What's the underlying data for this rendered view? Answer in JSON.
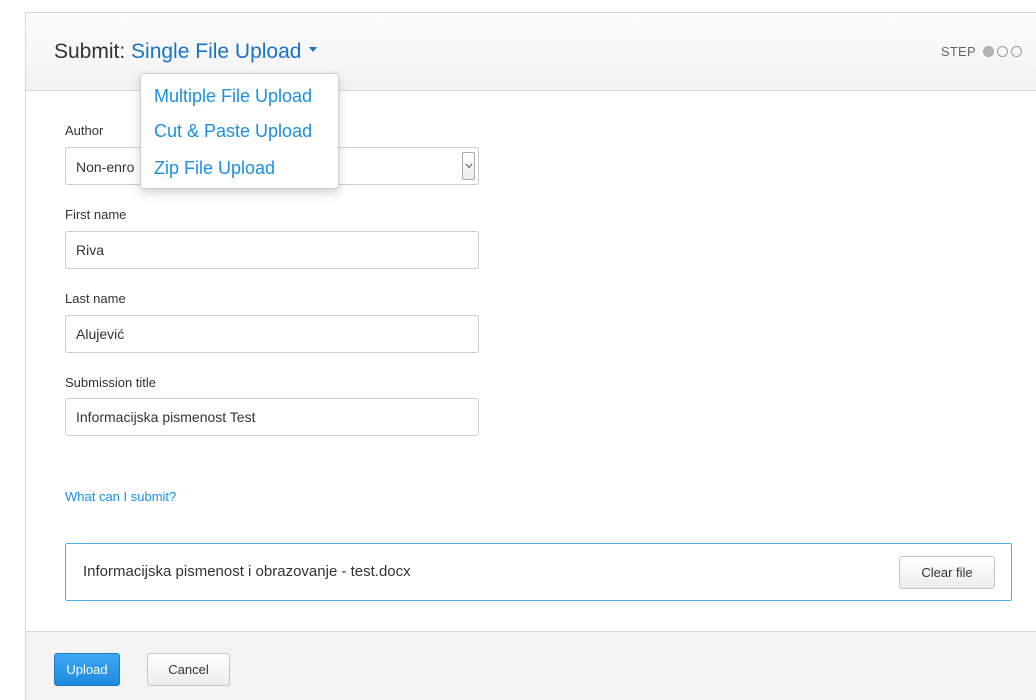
{
  "header": {
    "title_prefix": "Submit: ",
    "selected_type": "Single File Upload",
    "step_label": "STEP"
  },
  "dropdown": {
    "items": [
      {
        "label": "Multiple File Upload"
      },
      {
        "label": "Cut & Paste Upload"
      },
      {
        "label": "Zip File Upload"
      }
    ]
  },
  "form": {
    "author": {
      "label": "Author",
      "value": "Non-enro"
    },
    "first_name": {
      "label": "First name",
      "value": "Riva"
    },
    "last_name": {
      "label": "Last name",
      "value": "Alujević"
    },
    "submission_title": {
      "label": "Submission title",
      "value": "Informacijska pismenost Test"
    }
  },
  "help_link": "What can I submit?",
  "file": {
    "name": "Informacijska pismenost i obrazovanje - test.docx",
    "clear_label": "Clear file"
  },
  "footer": {
    "upload_label": "Upload",
    "cancel_label": "Cancel"
  },
  "colors": {
    "accent": "#1a8fe3",
    "primary_button": "#2196f3",
    "file_border": "#55aee8"
  },
  "icons": {
    "dropdown_caret": "caret-down-icon",
    "select_arrow": "chevron-down-icon"
  }
}
